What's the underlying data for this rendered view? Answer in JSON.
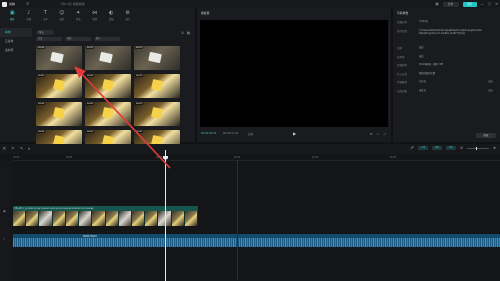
{
  "topbar": {
    "brand": "剪映",
    "menu_icon": "menu-icon",
    "project_title": "7月14日 视频编辑",
    "share_label": "分享",
    "export_label": "导出",
    "icons": [
      "layout-icon",
      "minimize-icon",
      "maximize-icon",
      "close-icon"
    ]
  },
  "media_panel": {
    "tools": [
      {
        "label": "媒体",
        "icon": "media-icon",
        "active": true
      },
      {
        "label": "音频",
        "icon": "audio-icon"
      },
      {
        "label": "文本",
        "icon": "text-icon"
      },
      {
        "label": "贴纸",
        "icon": "sticker-icon"
      },
      {
        "label": "特效",
        "icon": "effects-icon"
      },
      {
        "label": "转场",
        "icon": "transition-icon"
      },
      {
        "label": "滤镜",
        "icon": "filter-icon"
      },
      {
        "label": "调节",
        "icon": "adjust-icon"
      }
    ],
    "side_nav": [
      "本地",
      "云素材",
      "素材库"
    ],
    "crumb": "导入",
    "filters": [
      "全部",
      "视频",
      "图片"
    ],
    "thumbs": [
      {
        "duration": "00:04"
      },
      {
        "duration": "00:03"
      },
      {
        "duration": "00:03"
      },
      {
        "duration": "00:05"
      },
      {
        "duration": "00:04"
      },
      {
        "duration": "00:03"
      },
      {
        "duration": "00:04"
      },
      {
        "duration": "00:06"
      },
      {
        "duration": "00:03"
      },
      {
        "duration": "00:04"
      },
      {
        "duration": "00:03"
      },
      {
        "duration": "00:05"
      }
    ]
  },
  "player": {
    "title": "播放器",
    "timecode": "00:00:05:23",
    "total": "00:00:31:10",
    "ratio": "比例"
  },
  "props": {
    "title": "草稿参数",
    "rows": [
      {
        "k": "草稿名称",
        "v": "7月14日"
      },
      {
        "k": "保存位置",
        "v": "C:/Users/Administrator/AppData/Local/JianyingPro/User Data/Projects/com.lveditor.draft/7月14日",
        "multi": true
      },
      {
        "k": "比例",
        "v": "适应"
      },
      {
        "k": "分辨率",
        "v": "适应"
      },
      {
        "k": "草稿帧率",
        "v": "30.00帧/秒 · 帧率: 30f"
      },
      {
        "k": "导入方式",
        "v": "保留在原有位置"
      },
      {
        "k": "代理模式",
        "v": "已开启",
        "toggle": true
      },
      {
        "k": "自由层级",
        "v": "未开启",
        "toggle": true
      }
    ],
    "modify_label": "修改"
  },
  "timeline": {
    "ticks": [
      "00:00",
      "00:05",
      "00:10",
      "00:15",
      "00:20",
      "00:25"
    ],
    "video_clip_label": "7月14日_1_01  2022-07-14 12:05:31  2022-07-14 12:05:36  2022-07-14 12:05:40",
    "audio_clip_label": "轻快的节奏音乐",
    "chips": [
      "关闭",
      "吸附",
      "联动"
    ]
  },
  "colors": {
    "accent": "#32c8c8",
    "annotation_arrow": "#e23b3b"
  }
}
